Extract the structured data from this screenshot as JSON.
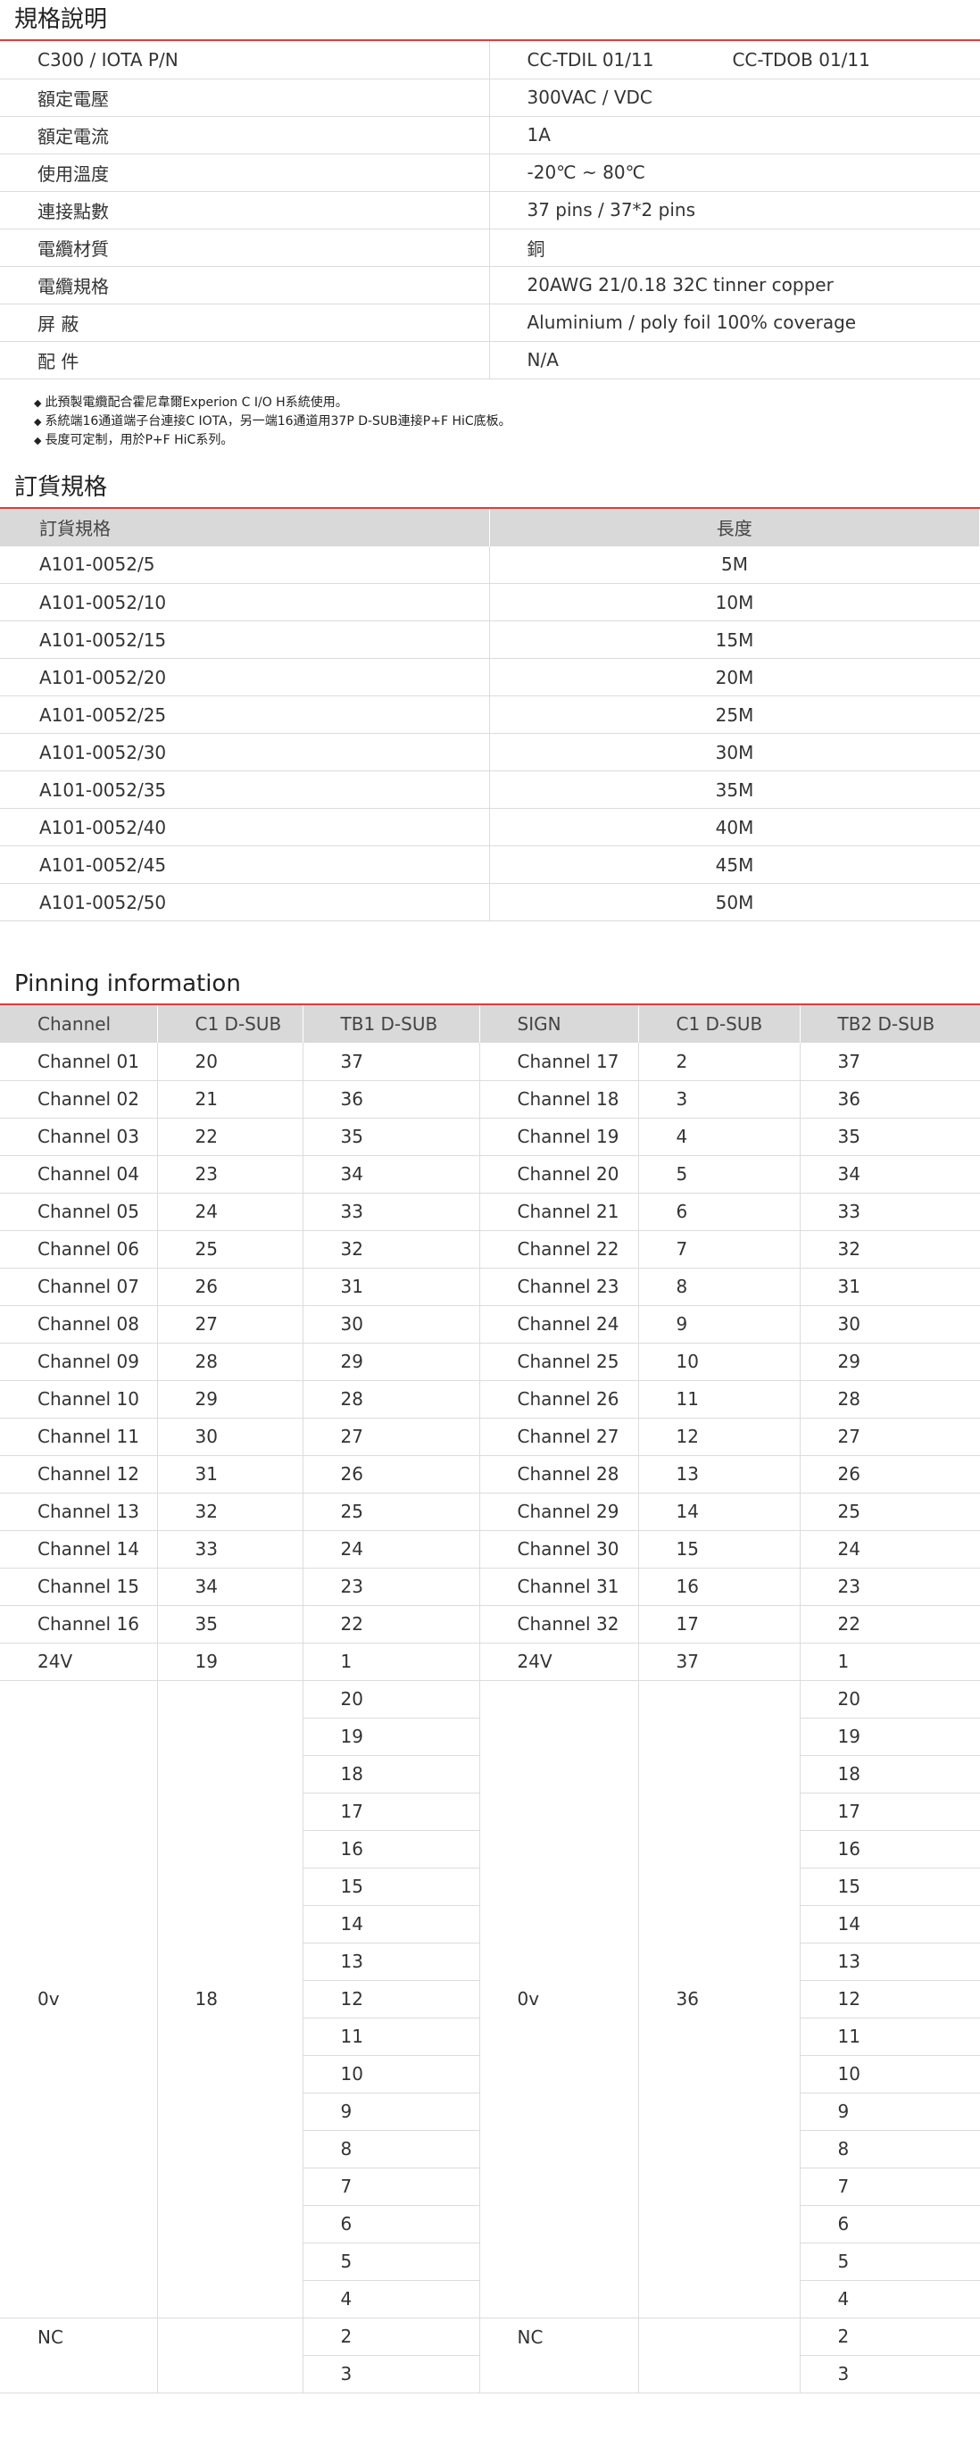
{
  "spec": {
    "title": "規格說明",
    "rows": [
      {
        "label": "C300 / IOTA  P/N",
        "value": "CC-TDIL 01/11",
        "value2": "CC-TDOB 01/11"
      },
      {
        "label": "額定電壓",
        "value": "300VAC / VDC"
      },
      {
        "label": "額定電流",
        "value": "1A"
      },
      {
        "label": "使用溫度",
        "value": "-20℃ ~ 80℃"
      },
      {
        "label": "連接點數",
        "value": "37 pins / 37*2 pins"
      },
      {
        "label": "電纜材質",
        "value": "銅"
      },
      {
        "label": "電纜規格",
        "value": "20AWG  21/0.18 32C tinner copper"
      },
      {
        "label": "屏 蔽",
        "value": "Aluminium / poly foil 100% coverage"
      },
      {
        "label": "配 件",
        "value": "N/A"
      }
    ],
    "notes": [
      "此預製電纜配合霍尼韋爾Experion C I/O H系統使用。",
      "系統端16通道端子台連接C IOTA，另一端16通道用37P D-SUB連接P+F HiC底板。",
      "長度可定制，用於P+F HiC系列。"
    ]
  },
  "order": {
    "title": "訂貨規格",
    "headers": [
      "訂貨規格",
      "長度"
    ],
    "rows": [
      [
        "A101-0052/5",
        "5M"
      ],
      [
        "A101-0052/10",
        "10M"
      ],
      [
        "A101-0052/15",
        "15M"
      ],
      [
        "A101-0052/20",
        "20M"
      ],
      [
        "A101-0052/25",
        "25M"
      ],
      [
        "A101-0052/30",
        "30M"
      ],
      [
        "A101-0052/35",
        "35M"
      ],
      [
        "A101-0052/40",
        "40M"
      ],
      [
        "A101-0052/45",
        "45M"
      ],
      [
        "A101-0052/50",
        "50M"
      ]
    ]
  },
  "pinning": {
    "title": "Pinning information",
    "headers": [
      "Channel",
      "C1 D-SUB",
      "TB1 D-SUB",
      "SIGN",
      "C1 D-SUB",
      "TB2 D-SUB"
    ],
    "rows": [
      [
        "Channel 01",
        "20",
        "37",
        "Channel 17",
        "2",
        "37"
      ],
      [
        "Channel 02",
        "21",
        "36",
        "Channel 18",
        "3",
        "36"
      ],
      [
        "Channel 03",
        "22",
        "35",
        "Channel 19",
        "4",
        "35"
      ],
      [
        "Channel 04",
        "23",
        "34",
        "Channel 20",
        "5",
        "34"
      ],
      [
        "Channel 05",
        "24",
        "33",
        "Channel 21",
        "6",
        "33"
      ],
      [
        "Channel 06",
        "25",
        "32",
        "Channel 22",
        "7",
        "32"
      ],
      [
        "Channel 07",
        "26",
        "31",
        "Channel 23",
        "8",
        "31"
      ],
      [
        "Channel 08",
        "27",
        "30",
        "Channel 24",
        "9",
        "30"
      ],
      [
        "Channel 09",
        "28",
        "29",
        "Channel 25",
        "10",
        "29"
      ],
      [
        "Channel 10",
        "29",
        "28",
        "Channel 26",
        "11",
        "28"
      ],
      [
        "Channel 11",
        "30",
        "27",
        "Channel 27",
        "12",
        "27"
      ],
      [
        "Channel 12",
        "31",
        "26",
        "Channel 28",
        "13",
        "26"
      ],
      [
        "Channel 13",
        "32",
        "25",
        "Channel 29",
        "14",
        "25"
      ],
      [
        "Channel 14",
        "33",
        "24",
        "Channel 30",
        "15",
        "24"
      ],
      [
        "Channel 15",
        "34",
        "23",
        "Channel 31",
        "16",
        "23"
      ],
      [
        "Channel 16",
        "35",
        "22",
        "Channel 32",
        "17",
        "22"
      ],
      [
        "24V",
        "19",
        "1",
        "24V",
        "37",
        "1"
      ]
    ],
    "ov_group": {
      "label1": "0v",
      "c1": "18",
      "label2": "0v",
      "c2": "36",
      "tb": [
        "20",
        "19",
        "18",
        "17",
        "16",
        "15",
        "14",
        "13",
        "12",
        "11",
        "10",
        "9",
        "8",
        "7",
        "6",
        "5",
        "4"
      ]
    },
    "nc_group": {
      "label1": "NC",
      "label2": "NC",
      "tb": [
        "2",
        "3"
      ]
    }
  }
}
